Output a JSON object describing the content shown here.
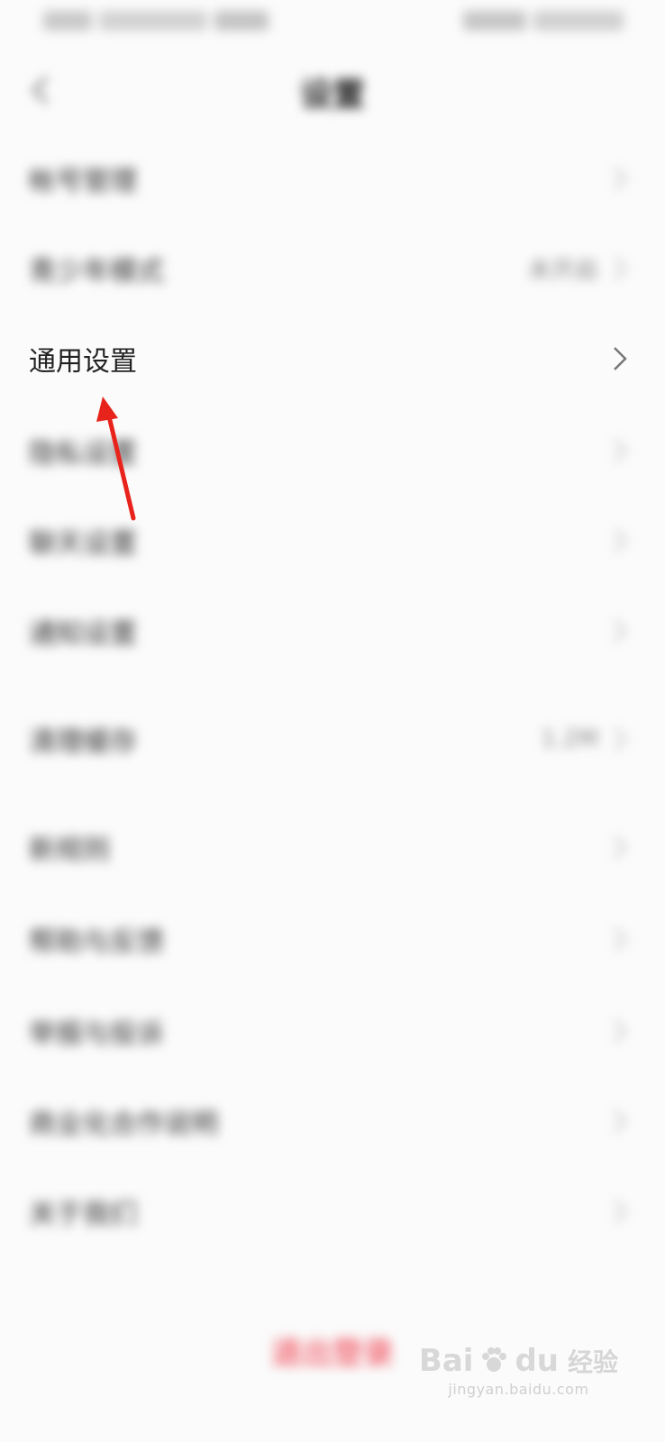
{
  "status_bar": {
    "left_icons": [
      "signal-icon",
      "wifi-icon",
      "app-notification-icon"
    ],
    "right_icons": [
      "battery-icon",
      "clock-icon"
    ]
  },
  "nav": {
    "back_icon": "chevron-left-icon",
    "title": "设置"
  },
  "rows": [
    {
      "label": "帐号管理",
      "value": "",
      "blurred": true
    },
    {
      "label": "青少年模式",
      "value": "未开启",
      "blurred": true
    },
    {
      "label": "通用设置",
      "value": "",
      "blurred": false
    },
    {
      "label": "隐私设置",
      "value": "",
      "blurred": true
    },
    {
      "label": "聊天设置",
      "value": "",
      "blurred": true
    },
    {
      "label": "通知设置",
      "value": "",
      "blurred": true
    },
    {
      "label": "清理缓存",
      "value": "1.2M",
      "blurred": true
    },
    {
      "label": "新规则",
      "value": "",
      "blurred": true
    },
    {
      "label": "帮助与反馈",
      "value": "",
      "blurred": true
    },
    {
      "label": "举报与投诉",
      "value": "",
      "blurred": true
    },
    {
      "label": "商业化合作说明",
      "value": "",
      "blurred": true
    },
    {
      "label": "关于我们",
      "value": "",
      "blurred": true
    }
  ],
  "logout_label": "退出登录",
  "watermark": {
    "brand": "Bai",
    "brand_suffix": "du",
    "brand_cn": "经验",
    "subtitle": "jingyan.baidu.com"
  },
  "colors": {
    "background": "#fbfbfb",
    "annotation_arrow": "#e8231b",
    "logout_text": "#f16d78"
  }
}
